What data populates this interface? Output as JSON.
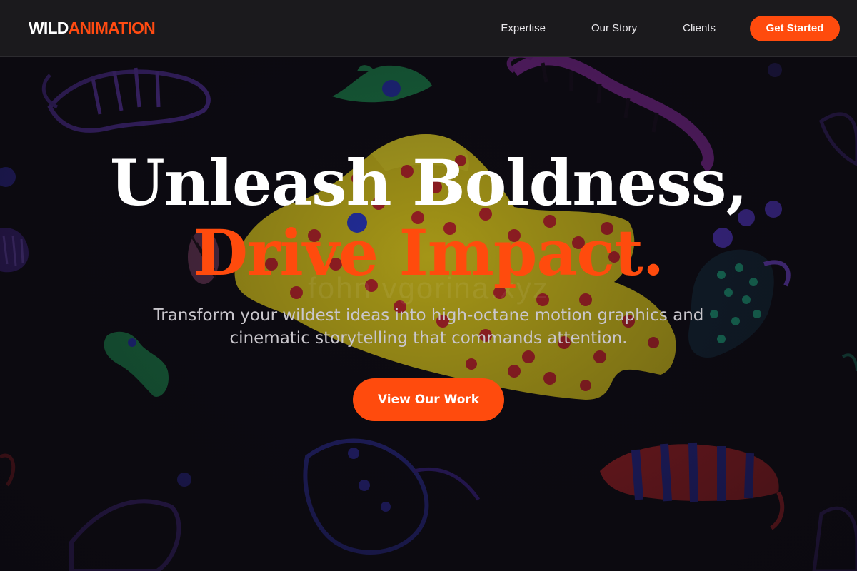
{
  "brand": {
    "logo_part1": "WILD",
    "logo_part2": "ANIMATION"
  },
  "nav": {
    "items": [
      {
        "label": "Expertise"
      },
      {
        "label": "Our Story"
      },
      {
        "label": "Clients"
      }
    ],
    "cta_label": "Get Started"
  },
  "hero": {
    "headline_line1": "Unleash Boldness,",
    "headline_line2": "Drive Impact.",
    "subheadline": "Transform your wildest ideas into high-octane motion graphics and cinematic storytelling that commands attention.",
    "cta_label": "View Our Work",
    "watermark": "fohn vgorina.xyz"
  },
  "colors": {
    "accent": "#ff4b0d",
    "header_bg": "#1b1a1d",
    "page_bg": "#0d0b12",
    "text_primary": "#ffffff",
    "text_secondary": "#c9c6cc"
  },
  "background_image": {
    "subject": "glowing-creatures-illustration"
  }
}
